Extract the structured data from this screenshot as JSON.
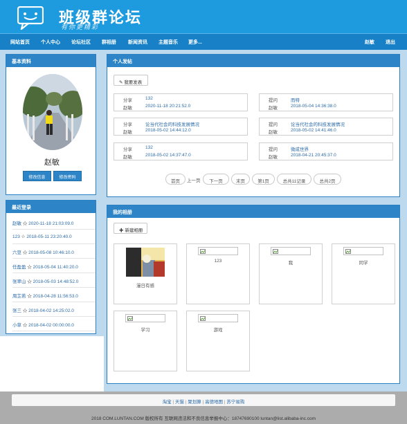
{
  "header": {
    "title": "班级群论坛",
    "slogan": "有你更精彩"
  },
  "nav": {
    "items": [
      "网站首页",
      "个人中心",
      "论坛社区",
      "群相册",
      "新闻资讯",
      "主题音乐",
      "更多..."
    ],
    "user": "赵敏",
    "logout": "退出"
  },
  "profile": {
    "title": "基本资料",
    "name": "赵敏",
    "edit_info": "修改信息",
    "edit_password": "修改密码"
  },
  "recent_logins": {
    "title": "最近登录",
    "star": "☆",
    "rows": [
      {
        "user": "赵敏",
        "time": "2020-11-18 21:03:09.0"
      },
      {
        "user": "123",
        "time": "2018-05-11 23:20:40.0"
      },
      {
        "user": "六豆",
        "time": "2018-05-08 10:46:10.0"
      },
      {
        "user": "任盈盈",
        "time": "2018-05-04 11:40:20.0"
      },
      {
        "user": "张翠山",
        "time": "2018-05-03 14:48:52.0"
      },
      {
        "user": "周芷若",
        "time": "2018-04-28 11:56:53.0"
      },
      {
        "user": "张三",
        "time": "2018-04-02 14:25:02.0"
      },
      {
        "user": "小草",
        "time": "2018-04-02 00:00:00.0"
      }
    ]
  },
  "posts": {
    "title": "个人发帖",
    "new_post": "我要发表",
    "items": [
      {
        "type": "分享",
        "subject": "132",
        "author": "赵敏",
        "time": "2020-11-18 20:21:52.0"
      },
      {
        "type": "提问",
        "subject": "而特",
        "author": "赵敏",
        "time": "2018-05-04 14:36:38.0"
      },
      {
        "type": "分享",
        "subject": "论当代社会的科技发展情况",
        "author": "赵敏",
        "time": "2018-05-02 14:44:12.0"
      },
      {
        "type": "提问",
        "subject": "论当代社会的科技发展情况",
        "author": "赵敏",
        "time": "2018-05-02 14:41:46.0"
      },
      {
        "type": "分享",
        "subject": "132",
        "author": "赵敏",
        "time": "2018-05-02 14:37:47.0"
      },
      {
        "type": "提问",
        "subject": "微成世界",
        "author": "赵敏",
        "time": "2018-04-21 20:45:37.0"
      }
    ],
    "pagination": {
      "first": "首页",
      "prev": "上一页",
      "next": "下一页",
      "last": "末页",
      "current": "第1页",
      "total_records": "总共11记录",
      "total_pages": "总共2页"
    }
  },
  "albums": {
    "title": "我的相册",
    "new_album": "新建相册",
    "items": [
      {
        "name": "漫日有感",
        "has_image": true
      },
      {
        "name": "123",
        "has_image": false
      },
      {
        "name": "我",
        "has_image": false
      },
      {
        "name": "同学",
        "has_image": false
      },
      {
        "name": "学习",
        "has_image": false
      },
      {
        "name": "游戏",
        "has_image": false
      }
    ]
  },
  "footer": {
    "links": [
      "淘宝",
      "天猫",
      "聚划算",
      "高德地图",
      "苏宁易购"
    ],
    "separator": "|",
    "copyright": "2018 COM.LUNTAN.COM 版权所有 互联网违法和不良信息举报中心：18747690100 luntan@list.alibaba-inc.com"
  },
  "colors": {
    "header_blue": "#1e9bde",
    "nav_blue": "#1780c6",
    "panel_blue": "#2d84c6",
    "link_blue": "#2b6aa8",
    "page_bg": "#bcd9ee"
  }
}
